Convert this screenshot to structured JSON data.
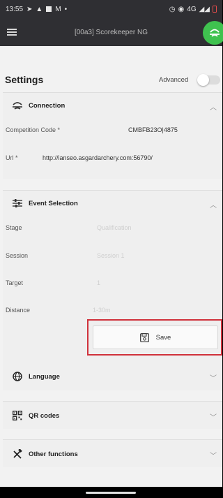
{
  "status_bar": {
    "time": "13:55",
    "network": "4G"
  },
  "app_bar": {
    "title": "[00a3] Scorekeeper NG"
  },
  "settings": {
    "title": "Settings",
    "advanced_label": "Advanced",
    "advanced_enabled": false
  },
  "connection": {
    "header": "Connection",
    "competition_code_label": "Competition Code *",
    "competition_code_value": "CMBFB23O|4875",
    "url_label": "Url *",
    "url_value": "http://ianseo.asgardarchery.com:56790/"
  },
  "event_selection": {
    "header": "Event Selection",
    "fields": [
      {
        "label": "Stage",
        "value": "Qualification"
      },
      {
        "label": "Session",
        "value": "Session 1"
      },
      {
        "label": "Target",
        "value": "1"
      },
      {
        "label": "Distance",
        "value": "1-30m"
      }
    ],
    "save_label": "Save"
  },
  "sections": [
    {
      "header": "Language",
      "icon": "globe-icon"
    },
    {
      "header": "QR codes",
      "icon": "qr-code-icon"
    },
    {
      "header": "Other functions",
      "icon": "tools-icon"
    }
  ],
  "colors": {
    "accent_green": "#3fc24f",
    "highlight_red": "#d0313b",
    "app_bar": "#2f2f33",
    "background": "#f2f2f2"
  }
}
